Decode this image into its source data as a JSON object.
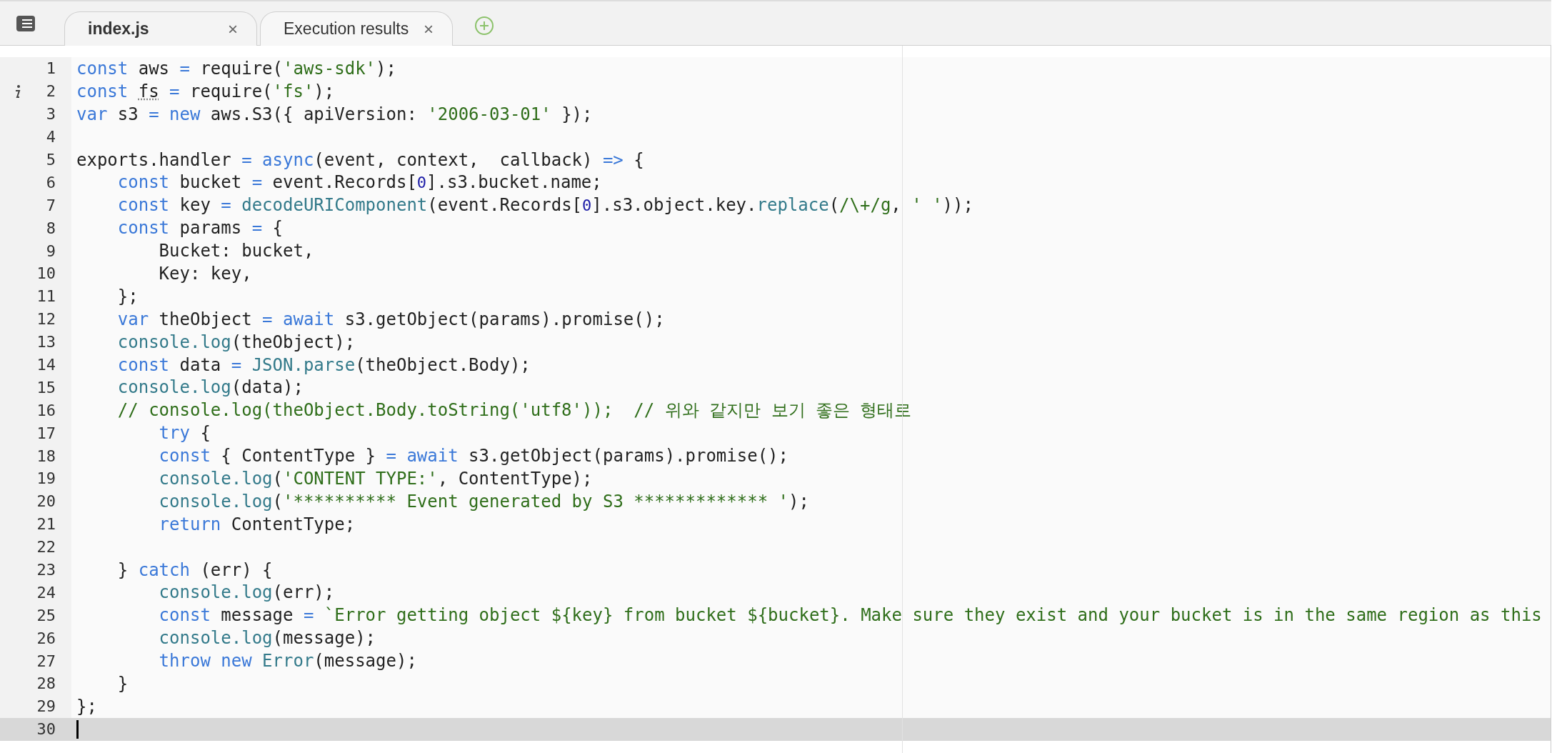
{
  "tabs": [
    {
      "label": "index.js",
      "selected": true,
      "close": "×"
    },
    {
      "label": "Execution results",
      "selected": false,
      "close": "×"
    }
  ],
  "editor": {
    "lines": [
      {
        "number": "1",
        "current": false,
        "info": false,
        "tokens": [
          {
            "kind": "kw",
            "text": "const"
          },
          {
            "kind": "plain",
            "text": " aws "
          },
          {
            "kind": "kw",
            "text": "="
          },
          {
            "kind": "plain",
            "text": " require("
          },
          {
            "kind": "str",
            "text": "'aws-sdk'"
          },
          {
            "kind": "plain",
            "text": ");"
          }
        ]
      },
      {
        "number": "2",
        "current": false,
        "info": true,
        "tokens": [
          {
            "kind": "kw",
            "text": "const "
          },
          {
            "kind": "warn",
            "text": "fs"
          },
          {
            "kind": "kw",
            "text": " ="
          },
          {
            "kind": "plain",
            "text": " require("
          },
          {
            "kind": "str",
            "text": "'fs'"
          },
          {
            "kind": "plain",
            "text": ");"
          }
        ]
      },
      {
        "number": "3",
        "current": false,
        "info": false,
        "tokens": [
          {
            "kind": "kw",
            "text": "var"
          },
          {
            "kind": "plain",
            "text": " s3 "
          },
          {
            "kind": "kw",
            "text": "= new"
          },
          {
            "kind": "plain",
            "text": " aws.S3({ apiVersion: "
          },
          {
            "kind": "str",
            "text": "'2006-03-01'"
          },
          {
            "kind": "plain",
            "text": " });"
          }
        ]
      },
      {
        "number": "4",
        "current": false,
        "info": false
      },
      {
        "number": "5",
        "current": false,
        "info": false,
        "tokens": [
          {
            "kind": "plain",
            "text": "exports.handler "
          },
          {
            "kind": "kw",
            "text": "= async"
          },
          {
            "kind": "plain",
            "text": "(event, context,  callback) "
          },
          {
            "kind": "kw",
            "text": "=>"
          },
          {
            "kind": "plain",
            "text": " {"
          }
        ]
      },
      {
        "number": "6",
        "current": false,
        "info": false,
        "tokens": [
          {
            "kind": "kw",
            "text": "    const"
          },
          {
            "kind": "plain",
            "text": " bucket "
          },
          {
            "kind": "kw",
            "text": "="
          },
          {
            "kind": "plain",
            "text": " event.Records["
          },
          {
            "kind": "num",
            "text": "0"
          },
          {
            "kind": "plain",
            "text": "].s3.bucket.name;"
          }
        ]
      },
      {
        "number": "7",
        "current": false,
        "info": false,
        "tokens": [
          {
            "kind": "kw",
            "text": "    const"
          },
          {
            "kind": "plain",
            "text": " key "
          },
          {
            "kind": "kw",
            "text": "="
          },
          {
            "kind": "builtin",
            "text": " decodeURIComponent"
          },
          {
            "kind": "plain",
            "text": "(event.Records["
          },
          {
            "kind": "num",
            "text": "0"
          },
          {
            "kind": "plain",
            "text": "].s3.object.key."
          },
          {
            "kind": "builtin",
            "text": "replace"
          },
          {
            "kind": "plain",
            "text": "("
          },
          {
            "kind": "str",
            "text": "/\\+/g"
          },
          {
            "kind": "plain",
            "text": ", "
          },
          {
            "kind": "str",
            "text": "' '"
          },
          {
            "kind": "plain",
            "text": "));"
          }
        ]
      },
      {
        "number": "8",
        "current": false,
        "info": false,
        "tokens": [
          {
            "kind": "kw",
            "text": "    const"
          },
          {
            "kind": "plain",
            "text": " params "
          },
          {
            "kind": "kw",
            "text": "="
          },
          {
            "kind": "plain",
            "text": " {"
          }
        ]
      },
      {
        "number": "9",
        "current": false,
        "info": false,
        "tokens": [
          {
            "kind": "plain",
            "text": "        Bucket: bucket,"
          }
        ]
      },
      {
        "number": "10",
        "current": false,
        "info": false,
        "tokens": [
          {
            "kind": "plain",
            "text": "        Key: key,"
          }
        ]
      },
      {
        "number": "11",
        "current": false,
        "info": false,
        "tokens": [
          {
            "kind": "plain",
            "text": "    };"
          }
        ]
      },
      {
        "number": "12",
        "current": false,
        "info": false,
        "tokens": [
          {
            "kind": "kw",
            "text": "    var"
          },
          {
            "kind": "plain",
            "text": " theObject "
          },
          {
            "kind": "kw",
            "text": "= await"
          },
          {
            "kind": "plain",
            "text": " s3.getObject(params).promise();"
          }
        ]
      },
      {
        "number": "13",
        "current": false,
        "info": false,
        "tokens": [
          {
            "kind": "builtin",
            "text": "    console.log"
          },
          {
            "kind": "plain",
            "text": "(theObject);"
          }
        ]
      },
      {
        "number": "14",
        "current": false,
        "info": false,
        "tokens": [
          {
            "kind": "kw",
            "text": "    const"
          },
          {
            "kind": "plain",
            "text": " data "
          },
          {
            "kind": "kw",
            "text": "="
          },
          {
            "kind": "builtin",
            "text": " JSON.parse"
          },
          {
            "kind": "plain",
            "text": "(theObject.Body);"
          }
        ]
      },
      {
        "number": "15",
        "current": false,
        "info": false,
        "tokens": [
          {
            "kind": "builtin",
            "text": "    console.log"
          },
          {
            "kind": "plain",
            "text": "(data);"
          }
        ]
      },
      {
        "number": "16",
        "current": false,
        "info": false,
        "tokens": [
          {
            "kind": "comment",
            "text": "    // console.log(theObject.Body.toString('utf8'));  // 위와 같지만 보기 좋은 형태로"
          }
        ]
      },
      {
        "number": "17",
        "current": false,
        "info": false,
        "tokens": [
          {
            "kind": "kw",
            "text": "        try"
          },
          {
            "kind": "plain",
            "text": " {"
          }
        ]
      },
      {
        "number": "18",
        "current": false,
        "info": false,
        "tokens": [
          {
            "kind": "kw",
            "text": "        const"
          },
          {
            "kind": "plain",
            "text": " { ContentType } "
          },
          {
            "kind": "kw",
            "text": "= await"
          },
          {
            "kind": "plain",
            "text": " s3.getObject(params).promise();"
          }
        ]
      },
      {
        "number": "19",
        "current": false,
        "info": false,
        "tokens": [
          {
            "kind": "builtin",
            "text": "        console.log"
          },
          {
            "kind": "plain",
            "text": "("
          },
          {
            "kind": "str",
            "text": "'CONTENT TYPE:'"
          },
          {
            "kind": "plain",
            "text": ", ContentType);"
          }
        ]
      },
      {
        "number": "20",
        "current": false,
        "info": false,
        "tokens": [
          {
            "kind": "builtin",
            "text": "        console.log"
          },
          {
            "kind": "plain",
            "text": "("
          },
          {
            "kind": "str",
            "text": "'********** Event generated by S3 ************* '"
          },
          {
            "kind": "plain",
            "text": ");"
          }
        ]
      },
      {
        "number": "21",
        "current": false,
        "info": false,
        "tokens": [
          {
            "kind": "kw",
            "text": "        return"
          },
          {
            "kind": "plain",
            "text": " ContentType;"
          }
        ]
      },
      {
        "number": "22",
        "current": false,
        "info": false
      },
      {
        "number": "23",
        "current": false,
        "info": false,
        "tokens": [
          {
            "kind": "plain",
            "text": "    } "
          },
          {
            "kind": "kw",
            "text": "catch"
          },
          {
            "kind": "plain",
            "text": " (err) {"
          }
        ]
      },
      {
        "number": "24",
        "current": false,
        "info": false,
        "tokens": [
          {
            "kind": "builtin",
            "text": "        console.log"
          },
          {
            "kind": "plain",
            "text": "(err);"
          }
        ]
      },
      {
        "number": "25",
        "current": false,
        "info": false,
        "tokens": [
          {
            "kind": "kw",
            "text": "        const"
          },
          {
            "kind": "plain",
            "text": " message "
          },
          {
            "kind": "kw",
            "text": "="
          },
          {
            "kind": "str",
            "text": " `Error getting object ${key} from bucket ${bucket}. Make sure they exist and your bucket is in the same region as this"
          }
        ]
      },
      {
        "number": "26",
        "current": false,
        "info": false,
        "tokens": [
          {
            "kind": "builtin",
            "text": "        console.log"
          },
          {
            "kind": "plain",
            "text": "(message);"
          }
        ]
      },
      {
        "number": "27",
        "current": false,
        "info": false,
        "tokens": [
          {
            "kind": "kw",
            "text": "        throw new"
          },
          {
            "kind": "builtin",
            "text": " Error"
          },
          {
            "kind": "plain",
            "text": "(message);"
          }
        ]
      },
      {
        "number": "28",
        "current": false,
        "info": false,
        "tokens": [
          {
            "kind": "plain",
            "text": "    }"
          }
        ]
      },
      {
        "number": "29",
        "current": false,
        "info": false,
        "tokens": [
          {
            "kind": "plain",
            "text": "};"
          }
        ]
      },
      {
        "number": "30",
        "current": true,
        "info": false
      }
    ]
  }
}
